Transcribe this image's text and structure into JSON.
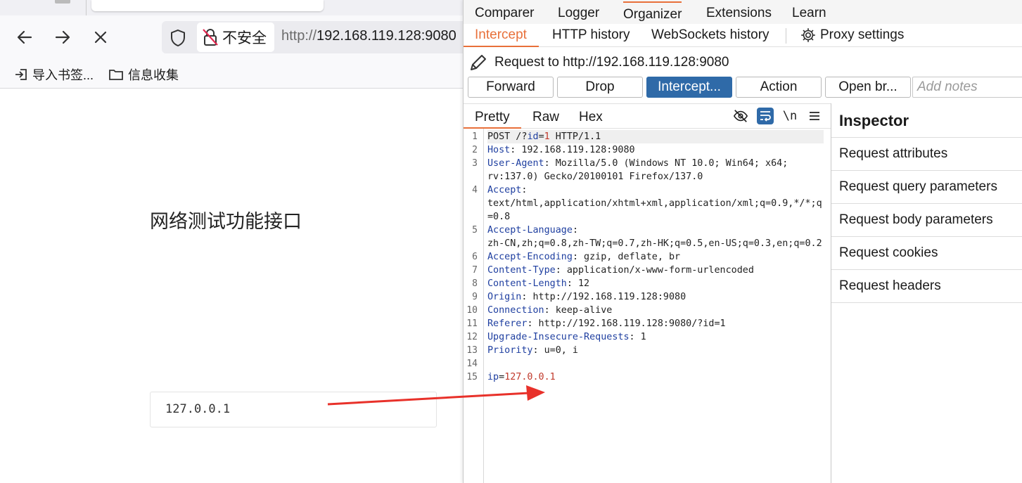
{
  "browser": {
    "nav": {
      "back_icon": "arrow-left-icon",
      "forward_icon": "arrow-right-icon",
      "stop_icon": "close-icon"
    },
    "urlbar": {
      "security_label": "不安全",
      "url_proto": "http://",
      "url_host": "192.168.119.128:9080"
    },
    "bookmarks": [
      {
        "label": "导入书签...",
        "icon": "import-icon"
      },
      {
        "label": "信息收集",
        "icon": "folder-icon"
      }
    ],
    "page": {
      "heading": "网络测试功能接口",
      "input_value": "127.0.0.1"
    }
  },
  "burp": {
    "top_tabs": [
      "Comparer",
      "Logger",
      "Organizer",
      "Extensions",
      "Learn"
    ],
    "sub_tabs": [
      "Intercept",
      "HTTP history",
      "WebSockets history"
    ],
    "proxy_settings": "Proxy settings",
    "request_title": "Request to http://192.168.119.128:9080",
    "buttons": {
      "forward": "Forward",
      "drop": "Drop",
      "intercept": "Intercept...",
      "action": "Action",
      "open_browser": "Open br..."
    },
    "notes_placeholder": "Add notes",
    "view_tabs": [
      "Pretty",
      "Raw",
      "Hex"
    ],
    "newline_toggle": "\\n",
    "request_lines": [
      {
        "n": "1",
        "parts": [
          [
            "",
            "POST /?"
          ],
          [
            "k",
            "id"
          ],
          [
            "",
            "="
          ],
          [
            "v",
            "1"
          ],
          [
            "",
            " HTTP/1.1"
          ]
        ]
      },
      {
        "n": "2",
        "parts": [
          [
            "k",
            "Host"
          ],
          [
            "",
            ": 192.168.119.128:9080"
          ]
        ]
      },
      {
        "n": "3",
        "parts": [
          [
            "k",
            "User-Agent"
          ],
          [
            "",
            ": Mozilla/5.0 (Windows NT 10.0; Win64; x64;"
          ]
        ]
      },
      {
        "n": "",
        "parts": [
          [
            "",
            "rv:137.0) Gecko/20100101 Firefox/137.0"
          ]
        ]
      },
      {
        "n": "4",
        "parts": [
          [
            "k",
            "Accept"
          ],
          [
            "",
            ":"
          ]
        ]
      },
      {
        "n": "",
        "parts": [
          [
            "",
            "text/html,application/xhtml+xml,application/xml;q=0.9,*/*;q"
          ]
        ]
      },
      {
        "n": "",
        "parts": [
          [
            "",
            "=0.8"
          ]
        ]
      },
      {
        "n": "5",
        "parts": [
          [
            "k",
            "Accept-Language"
          ],
          [
            "",
            ":"
          ]
        ]
      },
      {
        "n": "",
        "parts": [
          [
            "",
            "zh-CN,zh;q=0.8,zh-TW;q=0.7,zh-HK;q=0.5,en-US;q=0.3,en;q=0.2"
          ]
        ]
      },
      {
        "n": "6",
        "parts": [
          [
            "k",
            "Accept-Encoding"
          ],
          [
            "",
            ": gzip, deflate, br"
          ]
        ]
      },
      {
        "n": "7",
        "parts": [
          [
            "k",
            "Content-Type"
          ],
          [
            "",
            ": application/x-www-form-urlencoded"
          ]
        ]
      },
      {
        "n": "8",
        "parts": [
          [
            "k",
            "Content-Length"
          ],
          [
            "",
            ": 12"
          ]
        ]
      },
      {
        "n": "9",
        "parts": [
          [
            "k",
            "Origin"
          ],
          [
            "",
            ": http://192.168.119.128:9080"
          ]
        ]
      },
      {
        "n": "10",
        "parts": [
          [
            "k",
            "Connection"
          ],
          [
            "",
            ": keep-alive"
          ]
        ]
      },
      {
        "n": "11",
        "parts": [
          [
            "k",
            "Referer"
          ],
          [
            "",
            ": http://192.168.119.128:9080/?id=1"
          ]
        ]
      },
      {
        "n": "12",
        "parts": [
          [
            "k",
            "Upgrade-Insecure-Requests"
          ],
          [
            "",
            ": 1"
          ]
        ]
      },
      {
        "n": "13",
        "parts": [
          [
            "k",
            "Priority"
          ],
          [
            "",
            ": u=0, i"
          ]
        ]
      },
      {
        "n": "14",
        "parts": [
          [
            "",
            ""
          ]
        ]
      },
      {
        "n": "15",
        "parts": [
          [
            "k",
            "ip"
          ],
          [
            "",
            "="
          ],
          [
            "v",
            "127.0.0.1"
          ]
        ]
      }
    ],
    "inspector": {
      "title": "Inspector",
      "items": [
        "Request attributes",
        "Request query parameters",
        "Request body parameters",
        "Request cookies",
        "Request headers"
      ]
    },
    "colors": {
      "accent": "#e8703a",
      "primary_button": "#2f6aa8",
      "key": "#1f3fa0",
      "value": "#c0392b",
      "annotation_arrow": "#e8312a"
    }
  }
}
